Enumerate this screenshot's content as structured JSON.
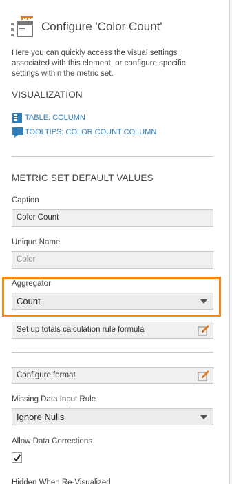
{
  "panel": {
    "title": "Configure 'Color Count'",
    "description": "Here you can quickly access the visual settings associated with this element, or configure specific settings within the metric set."
  },
  "visualization": {
    "heading": "VISUALIZATION",
    "links": [
      {
        "label": "TABLE: COLUMN",
        "icon": "table-column-icon"
      },
      {
        "label": "TOOLTIPS: COLOR COUNT COLUMN",
        "icon": "tooltip-icon"
      }
    ]
  },
  "defaults": {
    "heading": "METRIC SET DEFAULT VALUES",
    "caption_label": "Caption",
    "caption_value": "Color Count",
    "unique_name_label": "Unique Name",
    "unique_name_placeholder": "Color",
    "aggregator_label": "Aggregator",
    "aggregator_value": "Count",
    "totals_rule_label": "Set up totals calculation rule formula",
    "format_label": "Configure format",
    "missing_data_label": "Missing Data Input Rule",
    "missing_data_value": "Ignore Nulls",
    "allow_corrections_label": "Allow Data Corrections",
    "allow_corrections_checked": true,
    "hidden_label": "Hidden When Re-Visualized"
  },
  "colors": {
    "link": "#2f7fbf",
    "highlight": "#f28a1a",
    "icon_orange": "#e07b22",
    "icon_blue": "#2f7fbf"
  }
}
